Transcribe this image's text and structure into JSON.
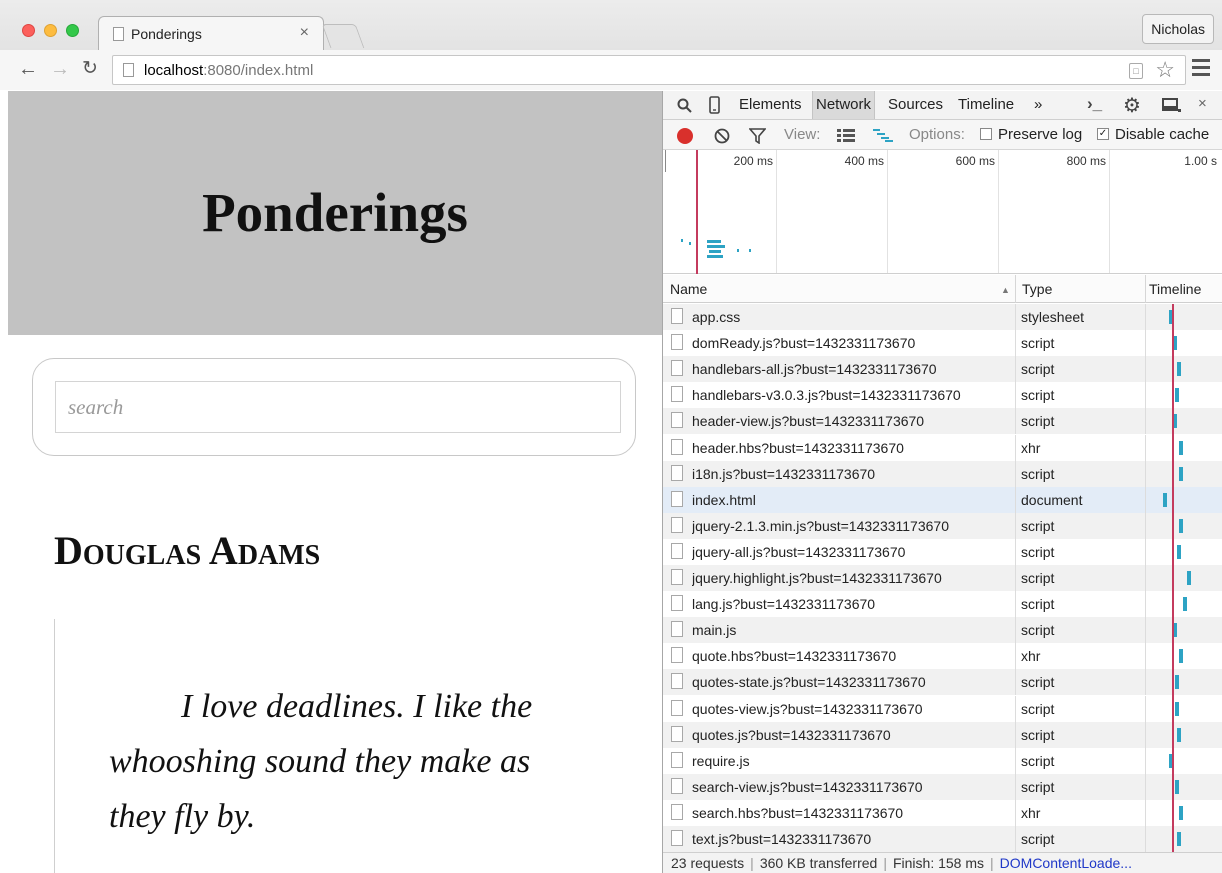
{
  "browser": {
    "tab_title": "Ponderings",
    "tab_close": "×",
    "profile_name": "Nicholas",
    "url_host": "localhost",
    "url_path": ":8080/index.html",
    "icons": [
      "back-arrow-icon",
      "forward-arrow-icon",
      "reload-icon",
      "page-icon",
      "star-icon",
      "menu-icon"
    ]
  },
  "page": {
    "site_title": "Ponderings",
    "search_placeholder": "search",
    "author": "Douglas Adams",
    "quote": "I love deadlines. I like the whooshing sound they make as they fly by."
  },
  "devtools": {
    "tabs": [
      "Elements",
      "Network",
      "Sources",
      "Timeline"
    ],
    "active_tab": "Network",
    "more_tabs": "»",
    "view_label": "View:",
    "options_label": "Options:",
    "preserve_log_label": "Preserve log",
    "preserve_log_checked": false,
    "disable_cache_label": "Disable cache",
    "disable_cache_checked": true,
    "overview_ticks": [
      "200 ms",
      "400 ms",
      "600 ms",
      "800 ms",
      "1.00 s"
    ],
    "columns": {
      "name": "Name",
      "type": "Type",
      "timeline": "Timeline"
    },
    "sort_indicator": "▲",
    "requests": [
      {
        "name": "app.css",
        "type": "stylesheet"
      },
      {
        "name": "domReady.js?bust=1432331173670",
        "type": "script"
      },
      {
        "name": "handlebars-all.js?bust=1432331173670",
        "type": "script"
      },
      {
        "name": "handlebars-v3.0.3.js?bust=1432331173670",
        "type": "script"
      },
      {
        "name": "header-view.js?bust=1432331173670",
        "type": "script"
      },
      {
        "name": "header.hbs?bust=1432331173670",
        "type": "xhr"
      },
      {
        "name": "i18n.js?bust=1432331173670",
        "type": "script"
      },
      {
        "name": "index.html",
        "type": "document"
      },
      {
        "name": "jquery-2.1.3.min.js?bust=1432331173670",
        "type": "script"
      },
      {
        "name": "jquery-all.js?bust=1432331173670",
        "type": "script"
      },
      {
        "name": "jquery.highlight.js?bust=1432331173670",
        "type": "script"
      },
      {
        "name": "lang.js?bust=1432331173670",
        "type": "script"
      },
      {
        "name": "main.js",
        "type": "script"
      },
      {
        "name": "quote.hbs?bust=1432331173670",
        "type": "xhr"
      },
      {
        "name": "quotes-state.js?bust=1432331173670",
        "type": "script"
      },
      {
        "name": "quotes-view.js?bust=1432331173670",
        "type": "script"
      },
      {
        "name": "quotes.js?bust=1432331173670",
        "type": "script"
      },
      {
        "name": "require.js",
        "type": "script"
      },
      {
        "name": "search-view.js?bust=1432331173670",
        "type": "script"
      },
      {
        "name": "search.hbs?bust=1432331173670",
        "type": "xhr"
      },
      {
        "name": "text.js?bust=1432331173670",
        "type": "script"
      }
    ],
    "selected_request": "index.html",
    "status": {
      "requests": "23 requests",
      "transferred": "360 KB transferred",
      "finish": "Finish: 158 ms",
      "dom_content_loaded": "DOMContentLoade..."
    },
    "colors": {
      "record": "#d9302c",
      "bar": "#2da3c4",
      "load_marker": "#c43b5e",
      "dcl_text": "#2038c8"
    }
  }
}
